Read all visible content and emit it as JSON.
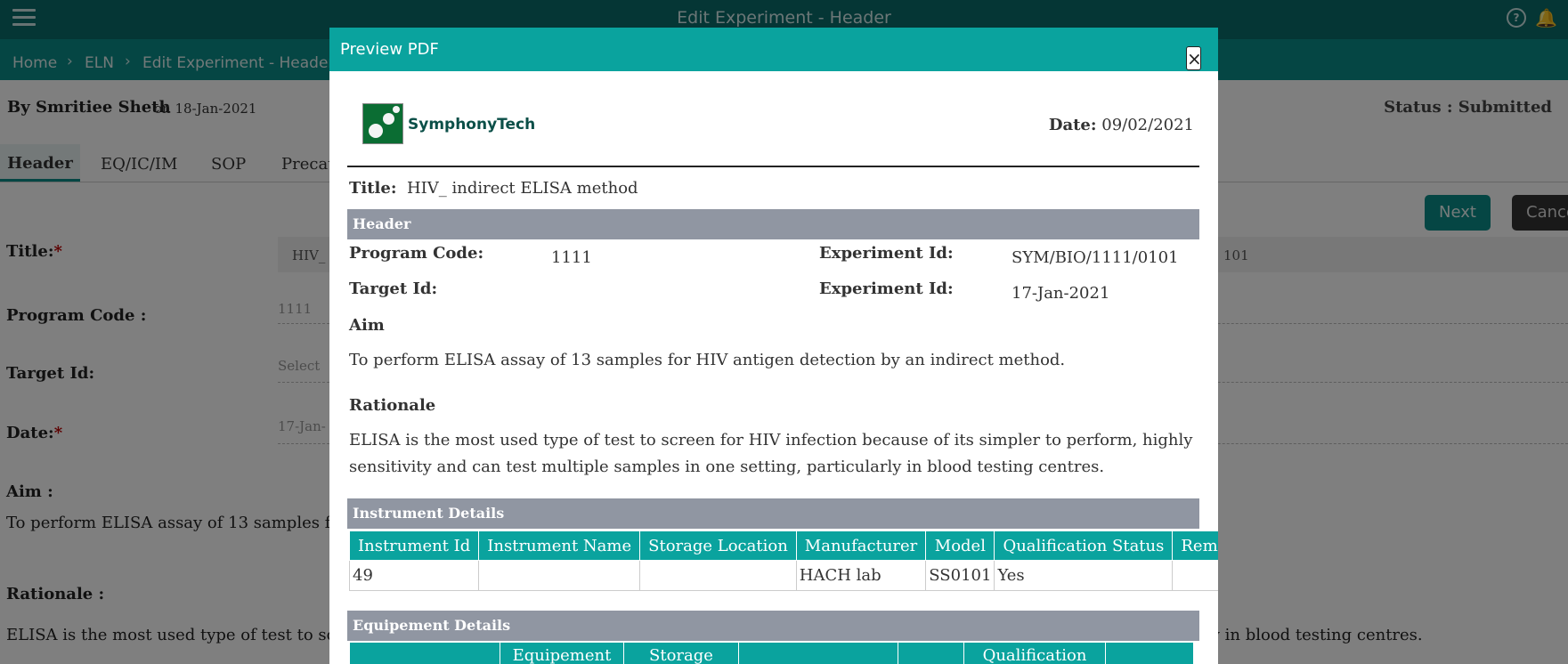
{
  "app": {
    "title": "Edit Experiment - Header"
  },
  "breadcrumb": [
    "Home",
    "ELN",
    "Edit Experiment - Header"
  ],
  "header": {
    "by": "By Smritiee Sheth",
    "on": "on 18-Jan-2021",
    "status": "Status : Submitted"
  },
  "tabs": [
    "Header",
    "EQ/IC/IM",
    "SOP",
    "Precau"
  ],
  "buttons": {
    "next": "Next",
    "cancel": "Cance"
  },
  "form": {
    "title_label": "Title:",
    "title_value": "HIV_",
    "title_tail": "101",
    "program_label": "Program Code :",
    "program_value": "1111",
    "target_label": "Target Id:",
    "target_placeholder": "Select",
    "date_label": "Date:",
    "date_value": "17-Jan-",
    "aim_label": "Aim :",
    "aim_text": "To perform ELISA assay of 13 samples for H",
    "rationale_label": "Rationale :",
    "rationale_text": "ELISA is the most used type of test to screen",
    "rationale_tail": "ly in blood testing centres.",
    "required_mark": "*"
  },
  "modal": {
    "title": "Preview PDF",
    "close": "×",
    "logo_text": "SymphonyTech",
    "date_label": "Date:",
    "date_value": "09/02/2021",
    "title_label": "Title:",
    "title_value": "HIV_ indirect ELISA method",
    "section_header": "Header",
    "program_code_label": "Program Code:",
    "program_code_value": "1111",
    "experiment_id_label": "Experiment Id:",
    "experiment_id_value": "SYM/BIO/1111/0101",
    "target_id_label": "Target Id:",
    "experiment_id2_label": "Experiment Id:",
    "experiment_id2_value": "17-Jan-2021",
    "aim_label": "Aim",
    "aim_text": "To perform ELISA assay of 13 samples for HIV antigen detection by an indirect method.",
    "rationale_label": "Rationale",
    "rationale_text": "ELISA is the most used type of test to screen for HIV infection because of its simpler to perform, highly sensitivity and can test multiple samples in one setting, particularly in blood testing centres.",
    "instrument_section": "Instrument Details",
    "instrument_columns": [
      "Instrument Id",
      "Instrument Name",
      "Storage Location",
      "Manufacturer",
      "Model",
      "Qualification Status",
      "Remark"
    ],
    "instrument_rows": [
      [
        "49",
        "",
        "",
        "HACH lab",
        "SS0101",
        "Yes",
        ""
      ]
    ],
    "equipment_section": "Equipement Details",
    "equipment_columns": [
      "",
      "Equipement",
      "Storage",
      "",
      "",
      "Qualification",
      ""
    ]
  }
}
